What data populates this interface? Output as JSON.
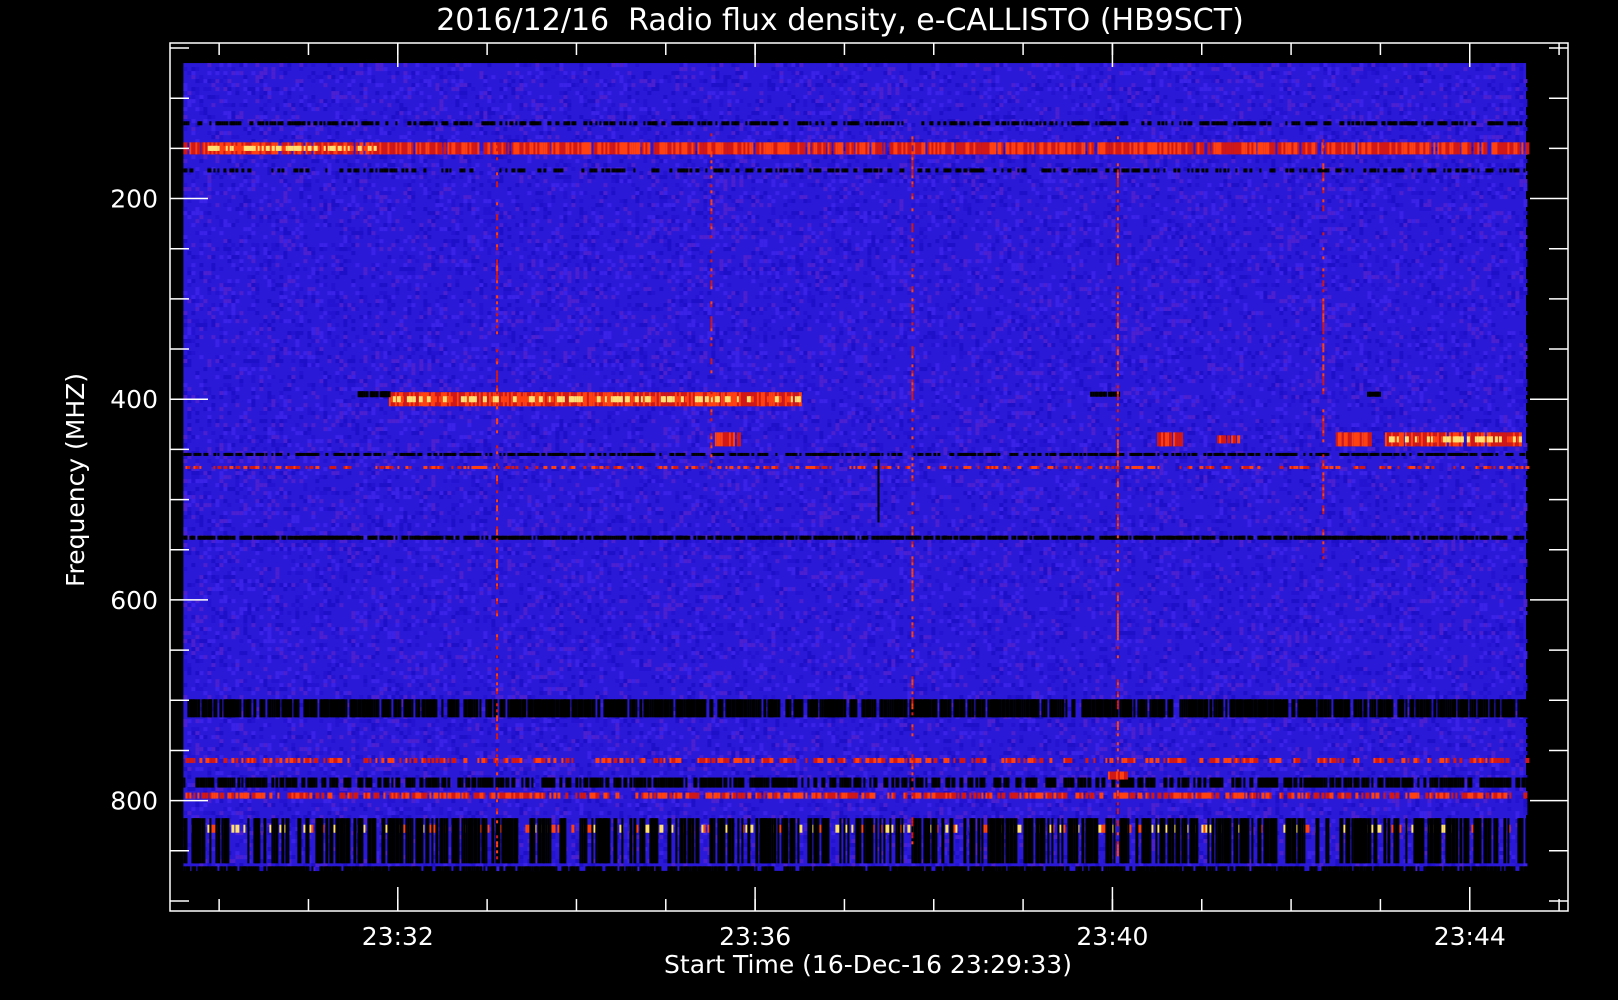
{
  "chart_data": {
    "type": "heatmap",
    "title": "2016/12/16  Radio flux density, e-CALLISTO (HB9SCT)",
    "xlabel": "Start Time (16-Dec-16 23:29:33)",
    "ylabel": "Frequency (MHZ)",
    "x_ticks": [
      "23:32",
      "23:36",
      "23:40",
      "23:44"
    ],
    "x_tick_minutes": [
      2.45,
      6.45,
      10.45,
      14.45
    ],
    "x_minor_step_minutes": 1,
    "x_range_minutes": [
      -0.1,
      15.55
    ],
    "data_x_range_minutes": [
      0.05,
      15.08
    ],
    "y_ticks": [
      "200",
      "400",
      "600",
      "800"
    ],
    "y_tick_values": [
      200,
      400,
      600,
      800
    ],
    "y_minor_step": 50,
    "y_range": [
      45,
      910
    ],
    "data_y_range": [
      65,
      870
    ],
    "colors": {
      "background": "#2a1ad8",
      "noise": [
        "#1e10c8",
        "#3a22e6",
        "#2414d2",
        "#4a20d0"
      ],
      "low": "#000000",
      "mid": "#d01818",
      "high": "#ff4010",
      "peak": "#ffe070"
    },
    "features": [
      {
        "kind": "band",
        "freq": 150,
        "width": 12,
        "t0": 0.05,
        "t1": 15.08,
        "color": "red",
        "dense": 0.85
      },
      {
        "kind": "band",
        "freq": 150,
        "width": 5,
        "t0": 0.3,
        "t1": 2.2,
        "color": "peak",
        "dense": 0.9
      },
      {
        "kind": "band",
        "freq": 125,
        "width": 4,
        "t0": 0.05,
        "t1": 15.08,
        "color": "dark",
        "dense": 0.5
      },
      {
        "kind": "band",
        "freq": 172,
        "width": 4,
        "t0": 0.05,
        "t1": 15.08,
        "color": "dark",
        "dense": 0.35
      },
      {
        "kind": "band",
        "freq": 400,
        "width": 14,
        "t0": 2.35,
        "t1": 6.95,
        "color": "red",
        "dense": 1.0
      },
      {
        "kind": "band",
        "freq": 400,
        "width": 6,
        "t0": 2.35,
        "t1": 6.95,
        "color": "peak",
        "dense": 0.6
      },
      {
        "kind": "band",
        "freq": 395,
        "width": 6,
        "t0": 2.0,
        "t1": 2.35,
        "color": "dark",
        "dense": 0.9
      },
      {
        "kind": "band",
        "freq": 395,
        "width": 5,
        "t0": 10.2,
        "t1": 10.5,
        "color": "dark",
        "dense": 0.9
      },
      {
        "kind": "band",
        "freq": 395,
        "width": 5,
        "t0": 13.3,
        "t1": 13.45,
        "color": "dark",
        "dense": 0.9
      },
      {
        "kind": "band",
        "freq": 440,
        "width": 14,
        "t0": 13.5,
        "t1": 15.02,
        "color": "red",
        "dense": 0.95
      },
      {
        "kind": "band",
        "freq": 440,
        "width": 6,
        "t0": 13.5,
        "t1": 15.02,
        "color": "peak",
        "dense": 0.6
      },
      {
        "kind": "band",
        "freq": 440,
        "width": 14,
        "t0": 12.95,
        "t1": 13.35,
        "color": "red",
        "dense": 0.95
      },
      {
        "kind": "band",
        "freq": 440,
        "width": 14,
        "t0": 10.95,
        "t1": 11.2,
        "color": "red",
        "dense": 0.95
      },
      {
        "kind": "band",
        "freq": 440,
        "width": 14,
        "t0": 6.0,
        "t1": 6.25,
        "color": "red",
        "dense": 0.95
      },
      {
        "kind": "band",
        "freq": 440,
        "width": 8,
        "t0": 11.6,
        "t1": 11.85,
        "color": "red",
        "dense": 0.7
      },
      {
        "kind": "band",
        "freq": 455,
        "width": 3,
        "t0": 0.05,
        "t1": 15.08,
        "color": "dark",
        "dense": 0.6
      },
      {
        "kind": "band",
        "freq": 468,
        "width": 3,
        "t0": 0.05,
        "t1": 15.08,
        "color": "red",
        "dense": 0.35
      },
      {
        "kind": "band",
        "freq": 538,
        "width": 4,
        "t0": 0.05,
        "t1": 15.08,
        "color": "dark",
        "dense": 0.8
      },
      {
        "kind": "band",
        "freq": 708,
        "width": 18,
        "t0": 0.05,
        "t1": 15.08,
        "color": "dark",
        "dense": 0.75
      },
      {
        "kind": "band",
        "freq": 760,
        "width": 5,
        "t0": 0.05,
        "t1": 15.08,
        "color": "red",
        "dense": 0.45
      },
      {
        "kind": "band",
        "freq": 782,
        "width": 10,
        "t0": 0.05,
        "t1": 15.08,
        "color": "dark",
        "dense": 0.6
      },
      {
        "kind": "band",
        "freq": 795,
        "width": 6,
        "t0": 0.05,
        "t1": 15.08,
        "color": "red",
        "dense": 0.55
      },
      {
        "kind": "band",
        "freq": 828,
        "width": 8,
        "t0": 0.05,
        "t1": 15.08,
        "color": "peak",
        "dense": 0.25
      },
      {
        "kind": "band",
        "freq": 840,
        "width": 45,
        "t0": 0.05,
        "t1": 15.08,
        "color": "dark",
        "dense": 0.5
      },
      {
        "kind": "band",
        "freq": 868,
        "width": 5,
        "t0": 0.05,
        "t1": 15.08,
        "color": "dark",
        "dense": 0.8
      },
      {
        "kind": "vline",
        "t": 3.55,
        "f0": 135,
        "f1": 860,
        "color": "red",
        "dense": 0.45
      },
      {
        "kind": "vline",
        "t": 5.95,
        "f0": 135,
        "f1": 470,
        "color": "red",
        "dense": 0.5
      },
      {
        "kind": "vline",
        "t": 8.2,
        "f0": 135,
        "f1": 860,
        "color": "red",
        "dense": 0.45
      },
      {
        "kind": "vline",
        "t": 10.5,
        "f0": 135,
        "f1": 860,
        "color": "red",
        "dense": 0.5
      },
      {
        "kind": "vline",
        "t": 12.8,
        "f0": 135,
        "f1": 560,
        "color": "red",
        "dense": 0.45
      },
      {
        "kind": "vline",
        "t": 7.82,
        "f0": 460,
        "f1": 520,
        "color": "dark",
        "dense": 1.0
      },
      {
        "kind": "band",
        "freq": 775,
        "width": 8,
        "t0": 10.4,
        "t1": 10.6,
        "color": "red",
        "dense": 1.0
      }
    ]
  }
}
